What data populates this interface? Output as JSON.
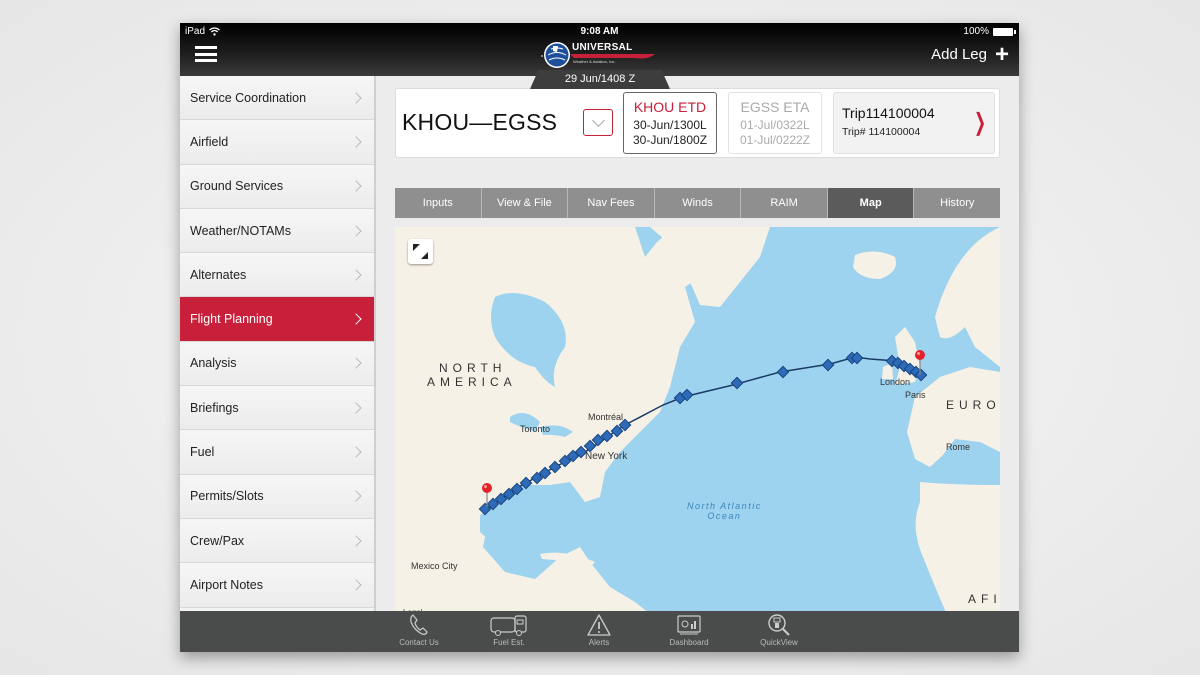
{
  "status_bar": {
    "device": "iPad",
    "time": "9:08 AM",
    "battery": "100%"
  },
  "header": {
    "logo_title": "UNIVERSAL",
    "logo_subtitle": "Weather & Aviation, Inc.",
    "date": "29 Jun/1408 Z",
    "add_leg_label": "Add Leg",
    "colors": {
      "brand_red": "#c8203a",
      "logo_blue": "#1d4f9c"
    }
  },
  "sidebar": {
    "items": [
      {
        "label": "Service Coordination",
        "active": false
      },
      {
        "label": "Airfield",
        "active": false
      },
      {
        "label": "Ground Services",
        "active": false
      },
      {
        "label": "Weather/NOTAMs",
        "active": false
      },
      {
        "label": "Alternates",
        "active": false
      },
      {
        "label": "Flight Planning",
        "active": true
      },
      {
        "label": "Analysis",
        "active": false
      },
      {
        "label": "Briefings",
        "active": false
      },
      {
        "label": "Fuel",
        "active": false
      },
      {
        "label": "Permits/Slots",
        "active": false
      },
      {
        "label": "Crew/Pax",
        "active": false
      },
      {
        "label": "Airport Notes",
        "active": false
      }
    ]
  },
  "leg": {
    "route": "KHOU—EGSS",
    "etd": {
      "title": "KHOU ETD",
      "local": "30-Jun/1300L",
      "zulu": "30-Jun/1800Z"
    },
    "eta": {
      "title": "EGSS ETA",
      "local": "01-Jul/0322L",
      "zulu": "01-Jul/0222Z"
    },
    "trip": {
      "name": "Trip114100004",
      "number": "Trip# 114100004"
    }
  },
  "tabs": [
    {
      "label": "Inputs",
      "active": false
    },
    {
      "label": "View & File",
      "active": false
    },
    {
      "label": "Nav Fees",
      "active": false
    },
    {
      "label": "Winds",
      "active": false
    },
    {
      "label": "RAIM",
      "active": false
    },
    {
      "label": "Map",
      "active": true
    },
    {
      "label": "History",
      "active": false
    }
  ],
  "map": {
    "labels": {
      "north_america_1": "NORTH",
      "north_america_2": "AMERICA",
      "europe": "EURO",
      "africa": "AFI",
      "ocean_1": "North Atlantic",
      "ocean_2": "Ocean",
      "montreal": "Montréal",
      "toronto": "Toronto",
      "new_york": "New York",
      "mexico_city": "Mexico City",
      "london": "London",
      "paris": "Paris",
      "rome": "Rome"
    },
    "legal": "Legal",
    "origin": "KHOU",
    "destination": "EGSS",
    "colors": {
      "water": "#9ed3ef",
      "land": "#f6f1e6",
      "route": "#1b3a66",
      "waypoint": "#2d6bb8",
      "pin": "#e3232a"
    }
  },
  "bottom_bar": {
    "items": [
      {
        "label": "Contact Us",
        "icon": "phone-icon"
      },
      {
        "label": "Fuel Est.",
        "icon": "fuel-truck-icon"
      },
      {
        "label": "Alerts",
        "icon": "alert-icon"
      },
      {
        "label": "Dashboard",
        "icon": "dashboard-icon"
      },
      {
        "label": "QuickView",
        "icon": "quickview-icon"
      }
    ]
  }
}
